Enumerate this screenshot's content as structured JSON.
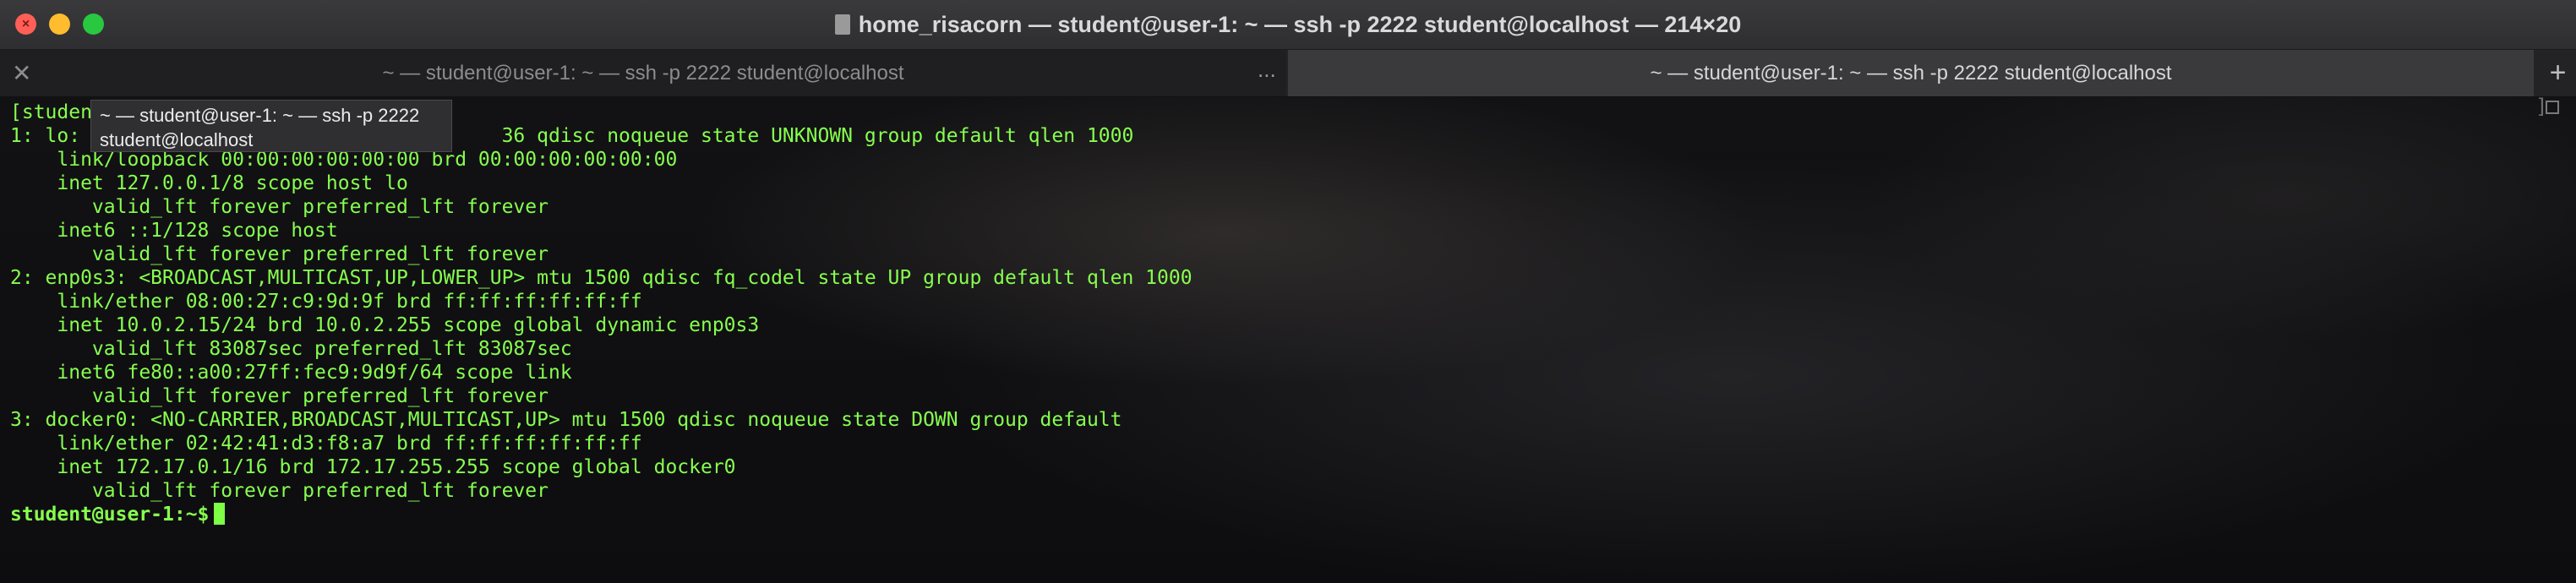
{
  "window": {
    "title": "home_risacorn — student@user-1: ~ — ssh -p 2222 student@localhost — 214×20",
    "close_symbol": "×"
  },
  "tabs": [
    {
      "label": "~ — student@user-1: ~ — ssh -p 2222 student@localhost",
      "active": false
    },
    {
      "label": "~ — student@user-1: ~ — ssh -p 2222 student@localhost",
      "active": true
    }
  ],
  "tabbar": {
    "close_symbol": "✕",
    "overflow_symbol": "...",
    "add_symbol": "+"
  },
  "tooltip": {
    "line1": "~ — student@user-1: ~ — ssh -p 2222",
    "line2": "student@localhost"
  },
  "terminal": {
    "lines": [
      "[student",
      "1: lo:                                    36 qdisc noqueue state UNKNOWN group default qlen 1000",
      "    link/loopback 00:00:00:00:00:00 brd 00:00:00:00:00:00",
      "    inet 127.0.0.1/8 scope host lo",
      "       valid_lft forever preferred_lft forever",
      "    inet6 ::1/128 scope host",
      "       valid_lft forever preferred_lft forever",
      "2: enp0s3: <BROADCAST,MULTICAST,UP,LOWER_UP> mtu 1500 qdisc fq_codel state UP group default qlen 1000",
      "    link/ether 08:00:27:c9:9d:9f brd ff:ff:ff:ff:ff:ff",
      "    inet 10.0.2.15/24 brd 10.0.2.255 scope global dynamic enp0s3",
      "       valid_lft 83087sec preferred_lft 83087sec",
      "    inet6 fe80::a00:27ff:fec9:9d9f/64 scope link",
      "       valid_lft forever preferred_lft forever",
      "3: docker0: <NO-CARRIER,BROADCAST,MULTICAST,UP> mtu 1500 qdisc noqueue state DOWN group default",
      "    link/ether 02:42:41:d3:f8:a7 brd ff:ff:ff:ff:ff:ff",
      "    inet 172.17.0.1/16 brd 172.17.255.255 scope global docker0",
      "       valid_lft forever preferred_lft forever"
    ],
    "prompt": "student@user-1:~$",
    "text_color": "#87ff4f"
  },
  "colors": {
    "close": "#ff5f57",
    "minimize": "#febc2e",
    "maximize": "#28c840"
  },
  "icons": [
    "close-icon",
    "minimize-icon",
    "maximize-icon",
    "document-icon",
    "tab-close-icon",
    "add-tab-icon"
  ]
}
